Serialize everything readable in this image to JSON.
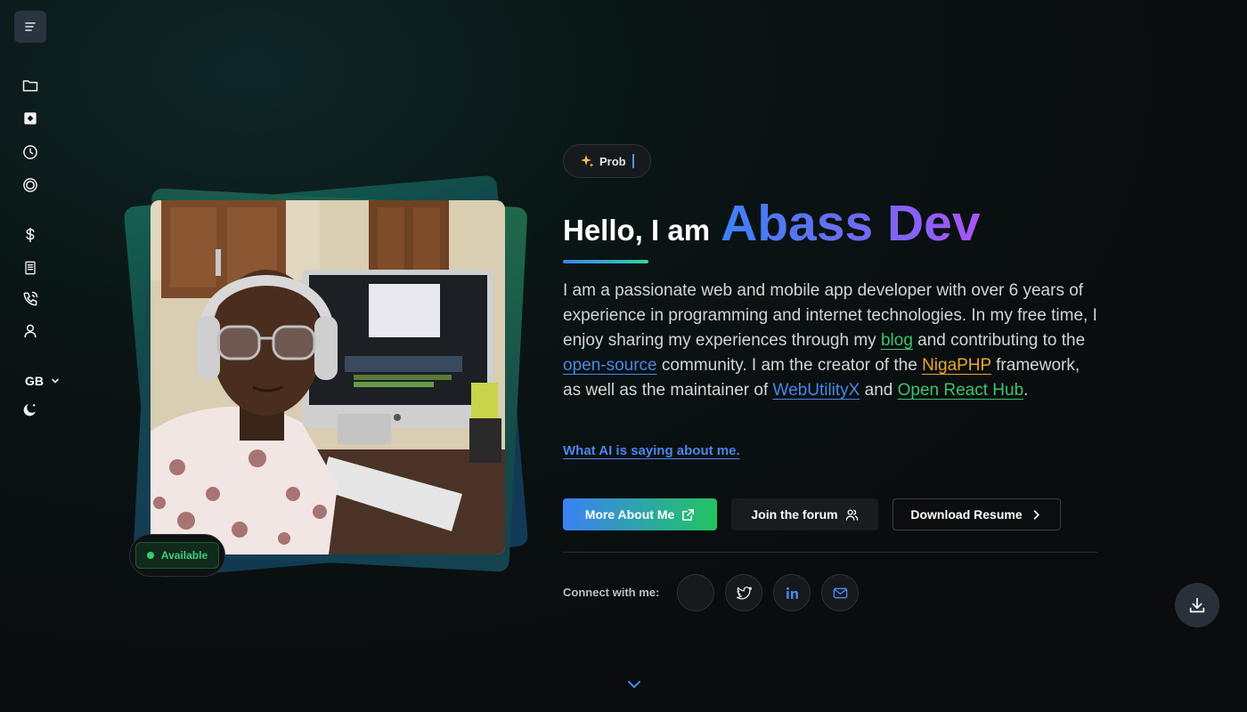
{
  "sidebar": {
    "menu_icon": "menu-icon",
    "items": [
      {
        "icon": "folder-icon"
      },
      {
        "icon": "game-icon"
      },
      {
        "icon": "clock-icon"
      },
      {
        "icon": "target-icon"
      },
      {
        "icon": "dollar-icon"
      },
      {
        "icon": "document-icon"
      },
      {
        "icon": "phone-icon"
      },
      {
        "icon": "user-icon"
      }
    ],
    "language": "GB",
    "theme_icon": "moon-icon"
  },
  "profile": {
    "status_badge": "Available"
  },
  "hero": {
    "typing_pill": "Prob",
    "greeting": "Hello, I am",
    "name": "Abass Dev",
    "bio": {
      "p1": "I am a passionate web and mobile app developer with over 6 years of experience in programming and internet technologies. In my free time, I enjoy sharing my experiences through my ",
      "link_blog": "blog",
      "p2": " and contributing to the ",
      "link_open_source": "open-source",
      "p3": " community. I am the creator of the ",
      "link_nigaphp": "NigaPHP",
      "p4": " framework, as well as the maintainer of ",
      "link_webutilityx": "WebUtilityX",
      "p5": " and ",
      "link_open_react_hub": "Open React Hub",
      "p6": "."
    },
    "ai_link": "What AI is saying about me.",
    "buttons": {
      "more_about": "More About Me",
      "join_forum": "Join the forum",
      "download_resume": "Download Resume"
    },
    "connect_label": "Connect with me:",
    "socials": [
      "github-icon",
      "twitter-icon",
      "linkedin-icon",
      "mail-icon"
    ]
  },
  "colors": {
    "accent_blue": "#3b82f6",
    "accent_green": "#22c55e",
    "accent_purple": "#a855f7",
    "link_amber": "#e9a82a"
  }
}
